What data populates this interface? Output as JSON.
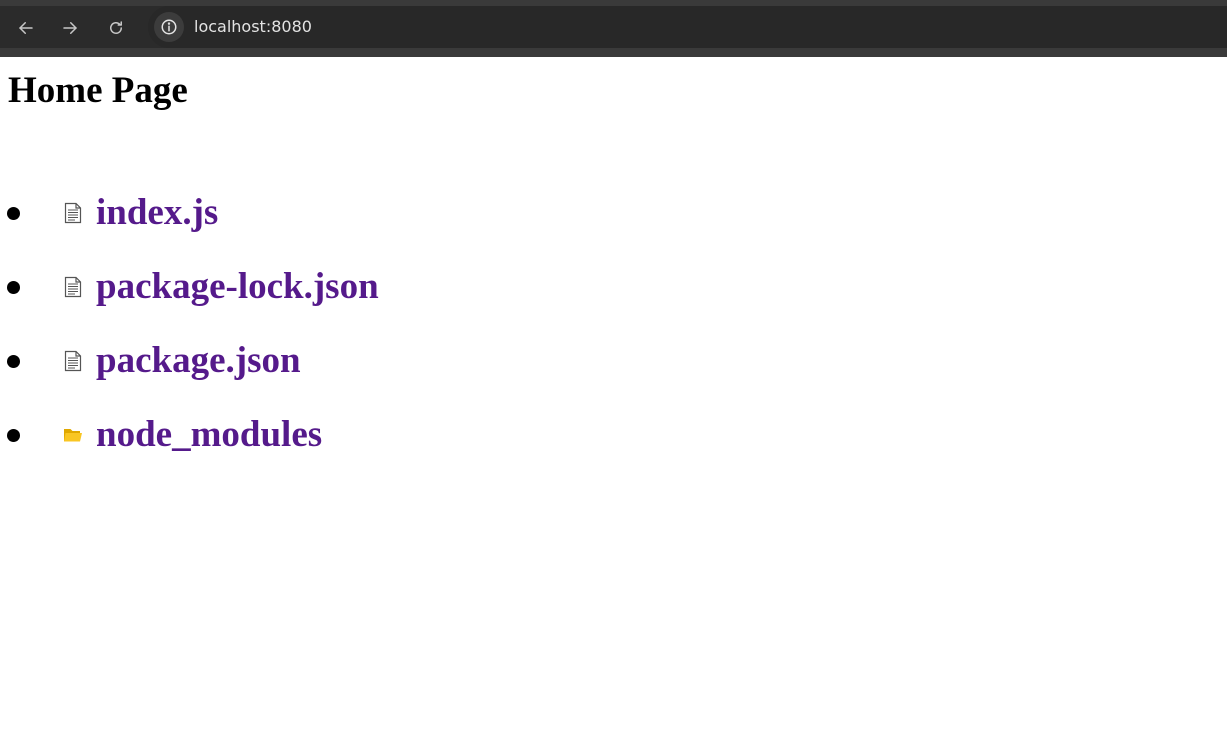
{
  "browser": {
    "url": "localhost:8080",
    "back_icon": "arrow-left-icon",
    "forward_icon": "arrow-right-icon",
    "reload_icon": "reload-icon",
    "site_info_icon": "info-icon"
  },
  "page": {
    "title": "Home Page",
    "items": [
      {
        "name": "index.js",
        "icon": "file-icon",
        "type": "file"
      },
      {
        "name": "package-lock.json",
        "icon": "file-icon",
        "type": "file"
      },
      {
        "name": "package.json",
        "icon": "file-icon",
        "type": "file"
      },
      {
        "name": "node_modules",
        "icon": "folder-icon",
        "type": "folder"
      }
    ]
  },
  "colors": {
    "visited_link": "#551a8b",
    "chrome_bg": "#2b2b2b",
    "folder": "#f9c623"
  }
}
